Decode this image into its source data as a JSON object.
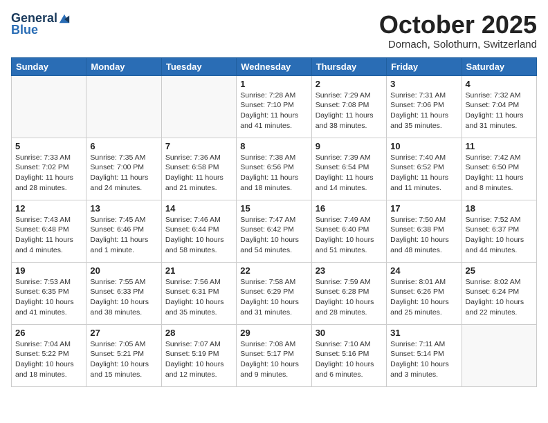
{
  "header": {
    "logo_general": "General",
    "logo_blue": "Blue",
    "month_title": "October 2025",
    "subtitle": "Dornach, Solothurn, Switzerland"
  },
  "weekdays": [
    "Sunday",
    "Monday",
    "Tuesday",
    "Wednesday",
    "Thursday",
    "Friday",
    "Saturday"
  ],
  "weeks": [
    [
      {
        "day": "",
        "info": ""
      },
      {
        "day": "",
        "info": ""
      },
      {
        "day": "",
        "info": ""
      },
      {
        "day": "1",
        "info": "Sunrise: 7:28 AM\nSunset: 7:10 PM\nDaylight: 11 hours and 41 minutes."
      },
      {
        "day": "2",
        "info": "Sunrise: 7:29 AM\nSunset: 7:08 PM\nDaylight: 11 hours and 38 minutes."
      },
      {
        "day": "3",
        "info": "Sunrise: 7:31 AM\nSunset: 7:06 PM\nDaylight: 11 hours and 35 minutes."
      },
      {
        "day": "4",
        "info": "Sunrise: 7:32 AM\nSunset: 7:04 PM\nDaylight: 11 hours and 31 minutes."
      }
    ],
    [
      {
        "day": "5",
        "info": "Sunrise: 7:33 AM\nSunset: 7:02 PM\nDaylight: 11 hours and 28 minutes."
      },
      {
        "day": "6",
        "info": "Sunrise: 7:35 AM\nSunset: 7:00 PM\nDaylight: 11 hours and 24 minutes."
      },
      {
        "day": "7",
        "info": "Sunrise: 7:36 AM\nSunset: 6:58 PM\nDaylight: 11 hours and 21 minutes."
      },
      {
        "day": "8",
        "info": "Sunrise: 7:38 AM\nSunset: 6:56 PM\nDaylight: 11 hours and 18 minutes."
      },
      {
        "day": "9",
        "info": "Sunrise: 7:39 AM\nSunset: 6:54 PM\nDaylight: 11 hours and 14 minutes."
      },
      {
        "day": "10",
        "info": "Sunrise: 7:40 AM\nSunset: 6:52 PM\nDaylight: 11 hours and 11 minutes."
      },
      {
        "day": "11",
        "info": "Sunrise: 7:42 AM\nSunset: 6:50 PM\nDaylight: 11 hours and 8 minutes."
      }
    ],
    [
      {
        "day": "12",
        "info": "Sunrise: 7:43 AM\nSunset: 6:48 PM\nDaylight: 11 hours and 4 minutes."
      },
      {
        "day": "13",
        "info": "Sunrise: 7:45 AM\nSunset: 6:46 PM\nDaylight: 11 hours and 1 minute."
      },
      {
        "day": "14",
        "info": "Sunrise: 7:46 AM\nSunset: 6:44 PM\nDaylight: 10 hours and 58 minutes."
      },
      {
        "day": "15",
        "info": "Sunrise: 7:47 AM\nSunset: 6:42 PM\nDaylight: 10 hours and 54 minutes."
      },
      {
        "day": "16",
        "info": "Sunrise: 7:49 AM\nSunset: 6:40 PM\nDaylight: 10 hours and 51 minutes."
      },
      {
        "day": "17",
        "info": "Sunrise: 7:50 AM\nSunset: 6:38 PM\nDaylight: 10 hours and 48 minutes."
      },
      {
        "day": "18",
        "info": "Sunrise: 7:52 AM\nSunset: 6:37 PM\nDaylight: 10 hours and 44 minutes."
      }
    ],
    [
      {
        "day": "19",
        "info": "Sunrise: 7:53 AM\nSunset: 6:35 PM\nDaylight: 10 hours and 41 minutes."
      },
      {
        "day": "20",
        "info": "Sunrise: 7:55 AM\nSunset: 6:33 PM\nDaylight: 10 hours and 38 minutes."
      },
      {
        "day": "21",
        "info": "Sunrise: 7:56 AM\nSunset: 6:31 PM\nDaylight: 10 hours and 35 minutes."
      },
      {
        "day": "22",
        "info": "Sunrise: 7:58 AM\nSunset: 6:29 PM\nDaylight: 10 hours and 31 minutes."
      },
      {
        "day": "23",
        "info": "Sunrise: 7:59 AM\nSunset: 6:28 PM\nDaylight: 10 hours and 28 minutes."
      },
      {
        "day": "24",
        "info": "Sunrise: 8:01 AM\nSunset: 6:26 PM\nDaylight: 10 hours and 25 minutes."
      },
      {
        "day": "25",
        "info": "Sunrise: 8:02 AM\nSunset: 6:24 PM\nDaylight: 10 hours and 22 minutes."
      }
    ],
    [
      {
        "day": "26",
        "info": "Sunrise: 7:04 AM\nSunset: 5:22 PM\nDaylight: 10 hours and 18 minutes."
      },
      {
        "day": "27",
        "info": "Sunrise: 7:05 AM\nSunset: 5:21 PM\nDaylight: 10 hours and 15 minutes."
      },
      {
        "day": "28",
        "info": "Sunrise: 7:07 AM\nSunset: 5:19 PM\nDaylight: 10 hours and 12 minutes."
      },
      {
        "day": "29",
        "info": "Sunrise: 7:08 AM\nSunset: 5:17 PM\nDaylight: 10 hours and 9 minutes."
      },
      {
        "day": "30",
        "info": "Sunrise: 7:10 AM\nSunset: 5:16 PM\nDaylight: 10 hours and 6 minutes."
      },
      {
        "day": "31",
        "info": "Sunrise: 7:11 AM\nSunset: 5:14 PM\nDaylight: 10 hours and 3 minutes."
      },
      {
        "day": "",
        "info": ""
      }
    ]
  ]
}
